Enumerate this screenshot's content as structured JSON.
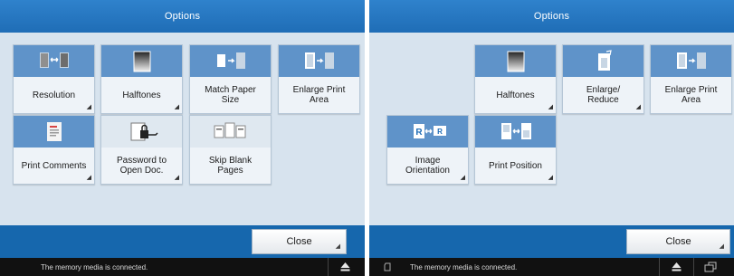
{
  "left_screen": {
    "title": "Options",
    "tiles": [
      {
        "label": "Resolution",
        "icon": "resolution-icon"
      },
      {
        "label": "Halftones",
        "icon": "halftones-icon"
      },
      {
        "label": "Match Paper\nSize",
        "icon": "match-paper-size-icon"
      },
      {
        "label": "Enlarge Print\nArea",
        "icon": "enlarge-print-area-icon"
      },
      {
        "label": "Print Comments",
        "icon": "print-comments-icon"
      },
      {
        "label": "Password to\nOpen Doc.",
        "icon": "password-icon"
      },
      {
        "label": "Skip Blank\nPages",
        "icon": "skip-blank-pages-icon"
      }
    ],
    "close_label": "Close",
    "status_text": "The memory media is connected."
  },
  "right_screen": {
    "title": "Options",
    "tiles": [
      {
        "label": "Halftones",
        "icon": "halftones-icon"
      },
      {
        "label": "Enlarge/\nReduce",
        "icon": "enlarge-reduce-icon"
      },
      {
        "label": "Enlarge Print\nArea",
        "icon": "enlarge-print-area-icon"
      },
      {
        "label": "Image\nOrientation",
        "icon": "image-orientation-icon"
      },
      {
        "label": "Print Position",
        "icon": "print-position-icon"
      }
    ],
    "close_label": "Close",
    "status_text": "The memory media is connected."
  },
  "colors": {
    "title_bar": "#1f6db6",
    "tile_icon_bg": "#5f93c9",
    "content_bg": "#d7e3ee",
    "bottom_bar": "#1667ad",
    "status_bar": "#111111"
  }
}
